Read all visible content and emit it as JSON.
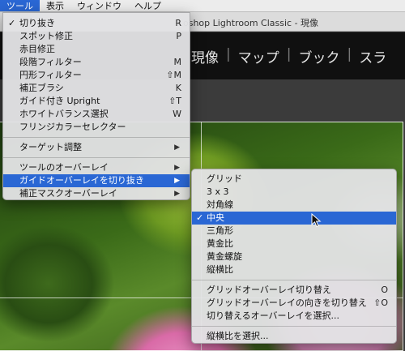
{
  "menubar": {
    "items": [
      {
        "label": "ツール"
      },
      {
        "label": "表示"
      },
      {
        "label": "ウィンドウ"
      },
      {
        "label": "ヘルプ"
      }
    ]
  },
  "window": {
    "title": "oshop Lightroom Classic - 現像"
  },
  "modules": {
    "items": [
      "現像",
      "マップ",
      "ブック",
      "スラ"
    ],
    "separator": "|"
  },
  "tools_menu": {
    "items": [
      {
        "label": "切り抜き",
        "shortcut": "R",
        "checked": true
      },
      {
        "label": "スポット修正",
        "shortcut": "P"
      },
      {
        "label": "赤目修正",
        "shortcut": ""
      },
      {
        "label": "段階フィルター",
        "shortcut": "M"
      },
      {
        "label": "円形フィルター",
        "shortcut": "⇧M"
      },
      {
        "label": "補正ブラシ",
        "shortcut": "K"
      },
      {
        "label": "ガイド付き Upright",
        "shortcut": "⇧T"
      },
      {
        "label": "ホワイトバランス選択",
        "shortcut": "W"
      },
      {
        "label": "フリンジカラーセレクター",
        "shortcut": ""
      }
    ],
    "group2": [
      {
        "label": "ターゲット調整",
        "submenu": true
      }
    ],
    "group3": [
      {
        "label": "ツールのオーバーレイ",
        "submenu": true
      },
      {
        "label": "ガイドオーバーレイを切り抜き",
        "submenu": true,
        "highlighted": true
      },
      {
        "label": "補正マスクオーバーレイ",
        "submenu": true
      }
    ]
  },
  "overlay_submenu": {
    "items": [
      {
        "label": "グリッド"
      },
      {
        "label": "3 x 3"
      },
      {
        "label": "対角線"
      },
      {
        "label": "中央",
        "checked": true,
        "highlighted": true
      },
      {
        "label": "三角形"
      },
      {
        "label": "黄金比"
      },
      {
        "label": "黄金螺旋"
      },
      {
        "label": "縦横比"
      }
    ],
    "group2": [
      {
        "label": "グリッドオーバーレイ切り替え",
        "shortcut": "O"
      },
      {
        "label": "グリッドオーバーレイの向きを切り替え",
        "shortcut": "⇧O"
      },
      {
        "label": "切り替えるオーバーレイを選択...",
        "shortcut": ""
      }
    ],
    "group3": [
      {
        "label": "縦横比を選択...",
        "shortcut": ""
      }
    ]
  },
  "glyphs": {
    "check": "✓",
    "arrow": "▶"
  },
  "colors": {
    "highlight": "#2a67d4"
  }
}
